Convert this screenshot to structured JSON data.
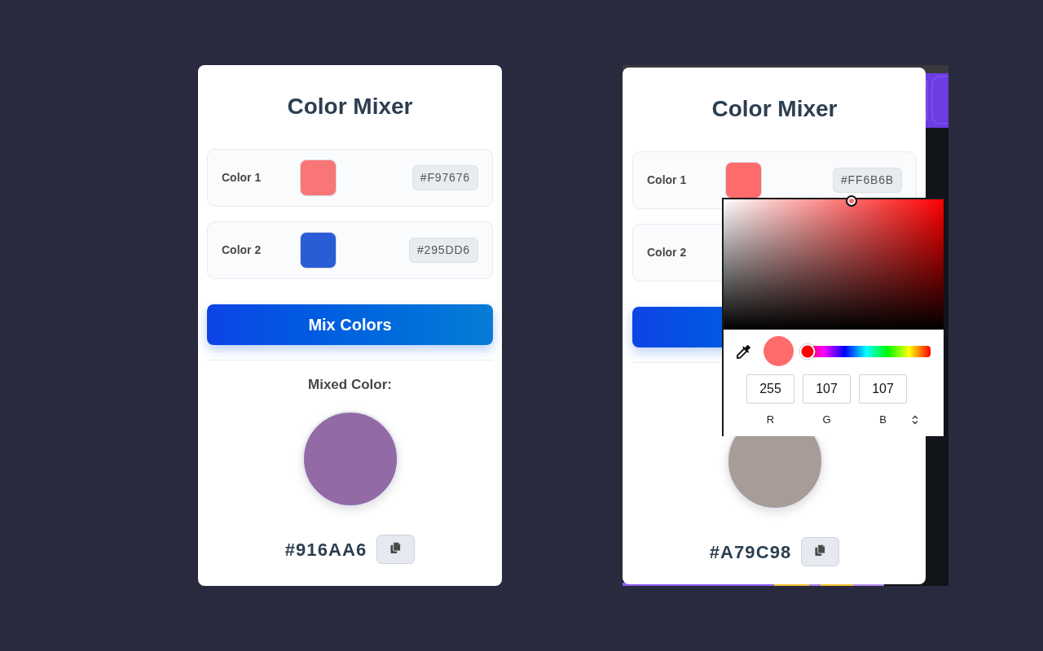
{
  "panels": [
    {
      "title": "Color Mixer",
      "colors": [
        {
          "label": "Color 1",
          "color": "#f97676",
          "hex": "#F97676"
        },
        {
          "label": "Color 2",
          "color": "#295dd6",
          "hex": "#295DD6"
        }
      ],
      "mix_button": "Mix Colors",
      "result_heading": "Mixed Color:",
      "result": {
        "color": "#916aa6",
        "hex": "#916AA6"
      }
    },
    {
      "title": "Color Mixer",
      "colors": [
        {
          "label": "Color 1",
          "color": "#ff6b6b",
          "hex": "#FF6B6B"
        },
        {
          "label": "Color 2"
        }
      ],
      "result": {
        "color": "#a79c98",
        "hex": "#A79C98"
      },
      "color_picker": {
        "hue_slider": {
          "level": 0
        },
        "channels": [
          {
            "label": "R",
            "value": "255"
          },
          {
            "label": "G",
            "value": "107"
          },
          {
            "label": "B",
            "value": "107"
          }
        ]
      }
    }
  ]
}
